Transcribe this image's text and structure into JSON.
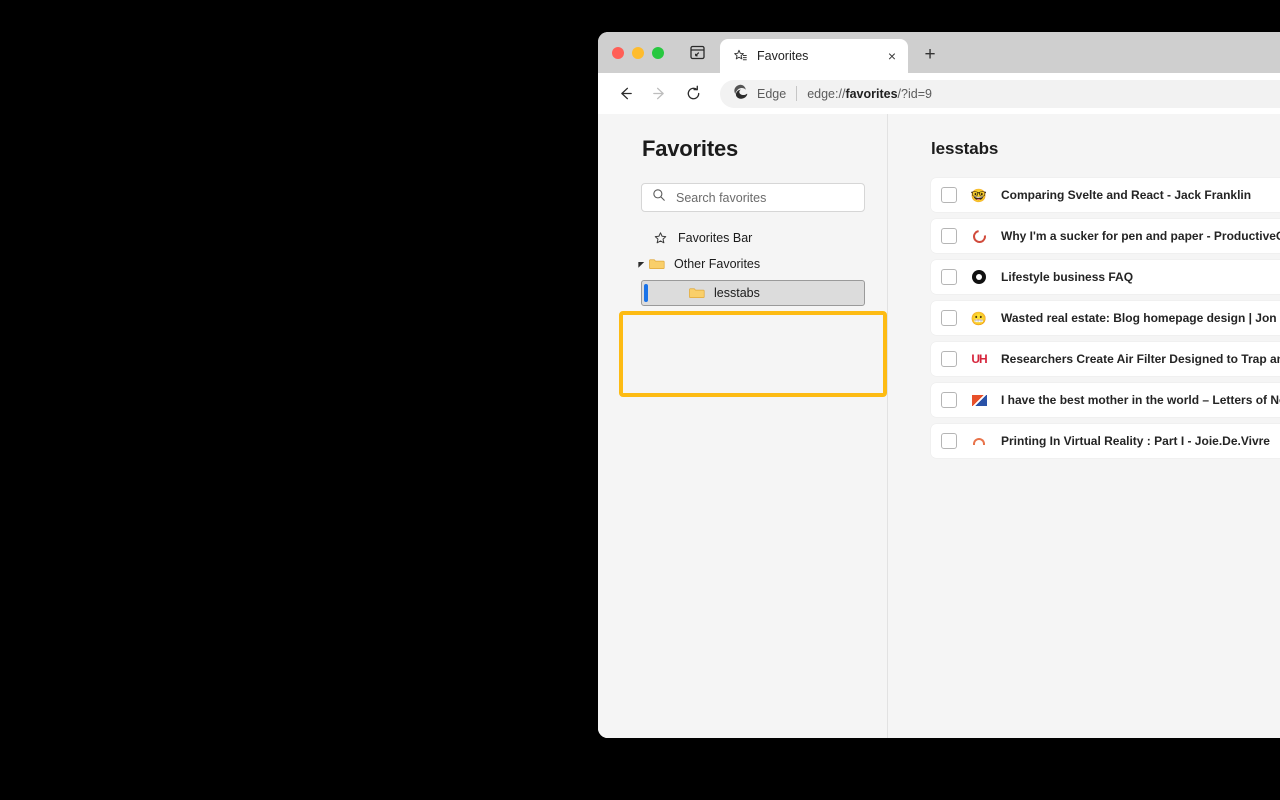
{
  "window": {
    "traffic_lights": [
      "close",
      "minimize",
      "maximize"
    ],
    "tab_actions_icon": "tab-actions-icon"
  },
  "tabstrip": {
    "tabs": [
      {
        "title": "Favorites",
        "favicon": "favorites-star-icon",
        "close_label": "×",
        "active": true
      }
    ],
    "new_tab_label": "+"
  },
  "toolbar": {
    "back_label": "←",
    "forward_label": "→",
    "reload_label": "⟳",
    "brand_label": "Edge",
    "url_prefix": "edge://",
    "url_bold": "favorites",
    "url_suffix": "/?id=9"
  },
  "sidebar": {
    "page_title": "Favorites",
    "search": {
      "placeholder": "Search favorites",
      "value": ""
    },
    "tree": [
      {
        "label": "Favorites Bar",
        "icon": "star-icon",
        "twisty": "",
        "selected": false
      },
      {
        "label": "Other Favorites",
        "icon": "folder-icon",
        "twisty": "◢",
        "selected": false
      },
      {
        "label": "lesstabs",
        "icon": "folder-icon",
        "twisty": "",
        "selected": true
      }
    ]
  },
  "main": {
    "folder_title": "lesstabs",
    "bookmarks": [
      {
        "title": "Comparing Svelte and React - Jack Franklin",
        "favicon": "nerd-face-emoji",
        "checked": false
      },
      {
        "title": "Why I'm a sucker for pen and paper - ProductiveGrowth",
        "favicon": "red-ring-icon",
        "checked": false
      },
      {
        "title": "Lifestyle business FAQ",
        "favicon": "black-bullseye-icon",
        "checked": false
      },
      {
        "title": "Wasted real estate: Blog homepage design | Jon Kuperman",
        "favicon": "grimacing-face-emoji",
        "checked": false
      },
      {
        "title": "Researchers Create Air Filter Designed to Trap and Kill the Coronavirus",
        "favicon": "uh-logo-icon",
        "checked": false
      },
      {
        "title": "I have the best mother in the world – Letters of Note",
        "favicon": "envelope-icon",
        "checked": false
      },
      {
        "title": "Printing In Virtual Reality : Part I - Joie.De.Vivre",
        "favicon": "orange-arch-icon",
        "checked": false
      }
    ]
  },
  "annotation": {
    "highlight_color": "#fdbb13",
    "selection_color": "#1a73e8"
  }
}
